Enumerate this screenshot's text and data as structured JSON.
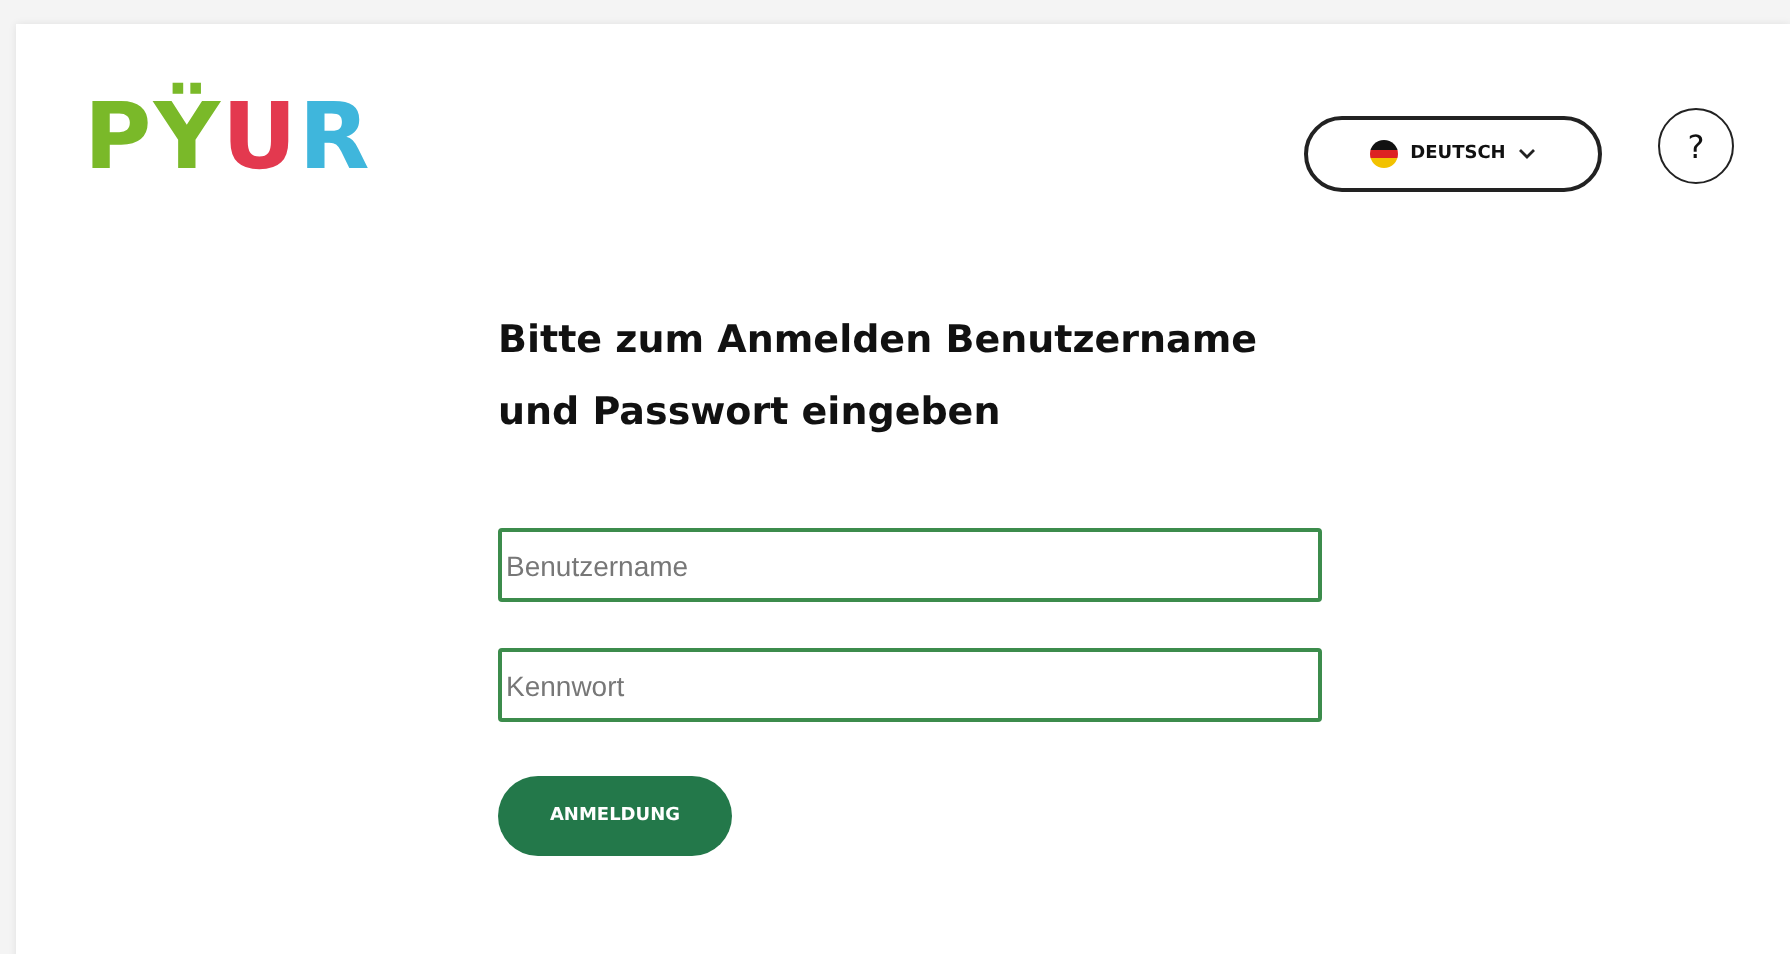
{
  "logo": {
    "letters": [
      {
        "text": "P",
        "color": "#7ab929"
      },
      {
        "text": "Ÿ",
        "color": "#7ab929"
      },
      {
        "text": "U",
        "color": "#e3394f"
      },
      {
        "text": "R",
        "color": "#3fb6dc"
      }
    ]
  },
  "language_button": {
    "label": "DEUTSCH"
  },
  "help_button": {
    "label": "?"
  },
  "heading": "Bitte zum Anmelden Benutzername und Passwort eingeben",
  "fields": [
    {
      "placeholder": "Benutzername"
    },
    {
      "placeholder": "Kennwort"
    }
  ],
  "submit_button": {
    "label": "ANMELDUNG"
  }
}
